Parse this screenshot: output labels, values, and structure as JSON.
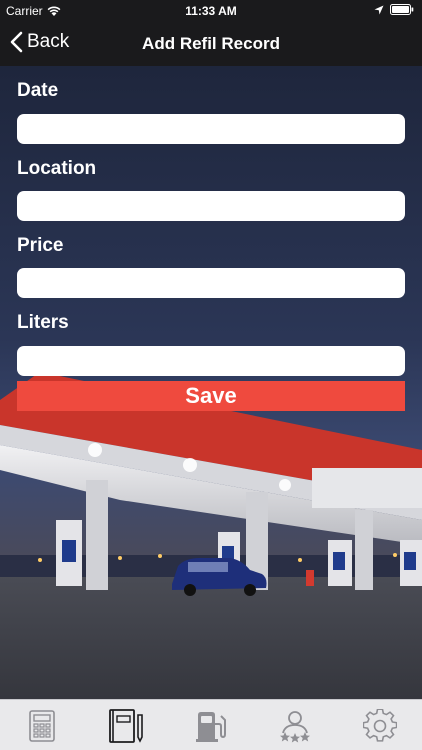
{
  "status_bar": {
    "carrier": "Carrier",
    "time": "11:33 AM"
  },
  "nav": {
    "back_label": "Back",
    "title": "Add Refil Record"
  },
  "form": {
    "date_label": "Date",
    "date_value": "",
    "location_label": "Location",
    "location_value": "",
    "price_label": "Price",
    "price_value": "",
    "liters_label": "Liters",
    "liters_value": "",
    "save_label": "Save"
  },
  "tab_bar": {
    "tabs": [
      {
        "icon": "calculator-icon"
      },
      {
        "icon": "notebook-icon",
        "selected": true
      },
      {
        "icon": "fuel-pump-icon"
      },
      {
        "icon": "user-ratings-icon"
      },
      {
        "icon": "gear-icon"
      }
    ]
  },
  "colors": {
    "save_button": "#ef4a3e",
    "nav_bar": "#1a1a1c",
    "tab_bar": "#e9e9eb"
  }
}
